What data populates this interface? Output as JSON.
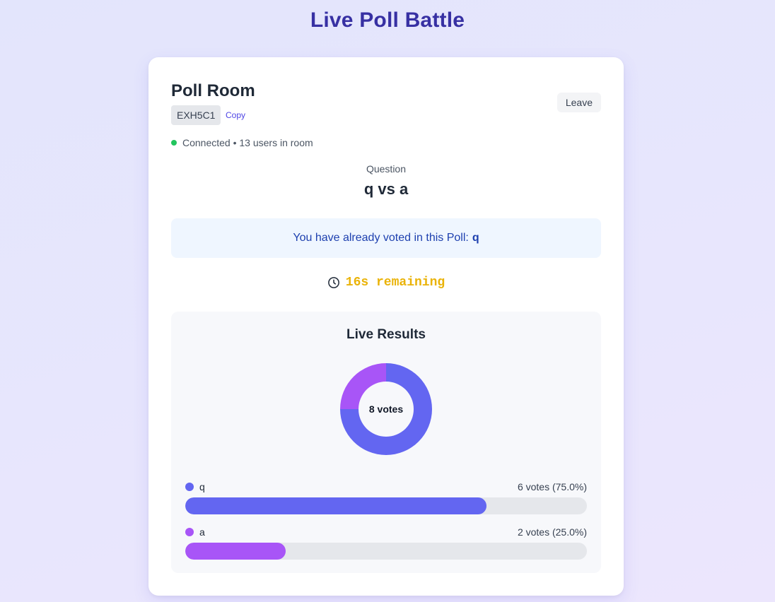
{
  "app": {
    "title": "Live Poll Battle"
  },
  "room": {
    "title": "Poll Room",
    "code": "EXH5C1",
    "copy_label": "Copy",
    "leave_label": "Leave",
    "status_text": "Connected • 13 users in room"
  },
  "question": {
    "label": "Question",
    "text": "q vs a"
  },
  "vote_notice": {
    "text": "You have already voted in this Poll:",
    "choice": "q"
  },
  "timer": {
    "text": "16s remaining",
    "icon": "clock-icon"
  },
  "results": {
    "title": "Live Results",
    "total_label": "8 votes",
    "options": [
      {
        "name": "q",
        "count_text": "6 votes (75.0%)",
        "votes": 6,
        "percent": 75.0,
        "color": "#6366f1"
      },
      {
        "name": "a",
        "count_text": "2 votes (25.0%)",
        "votes": 2,
        "percent": 25.0,
        "color": "#a855f7"
      }
    ]
  },
  "colors": {
    "title": "#3730a3",
    "connected": "#22c55e",
    "timer": "#eab308",
    "option_q": "#6366f1",
    "option_a": "#a855f7"
  },
  "chart_data": {
    "type": "pie",
    "categories": [
      "q",
      "a"
    ],
    "values": [
      6,
      2
    ],
    "title": "",
    "center_label": "8 votes"
  }
}
